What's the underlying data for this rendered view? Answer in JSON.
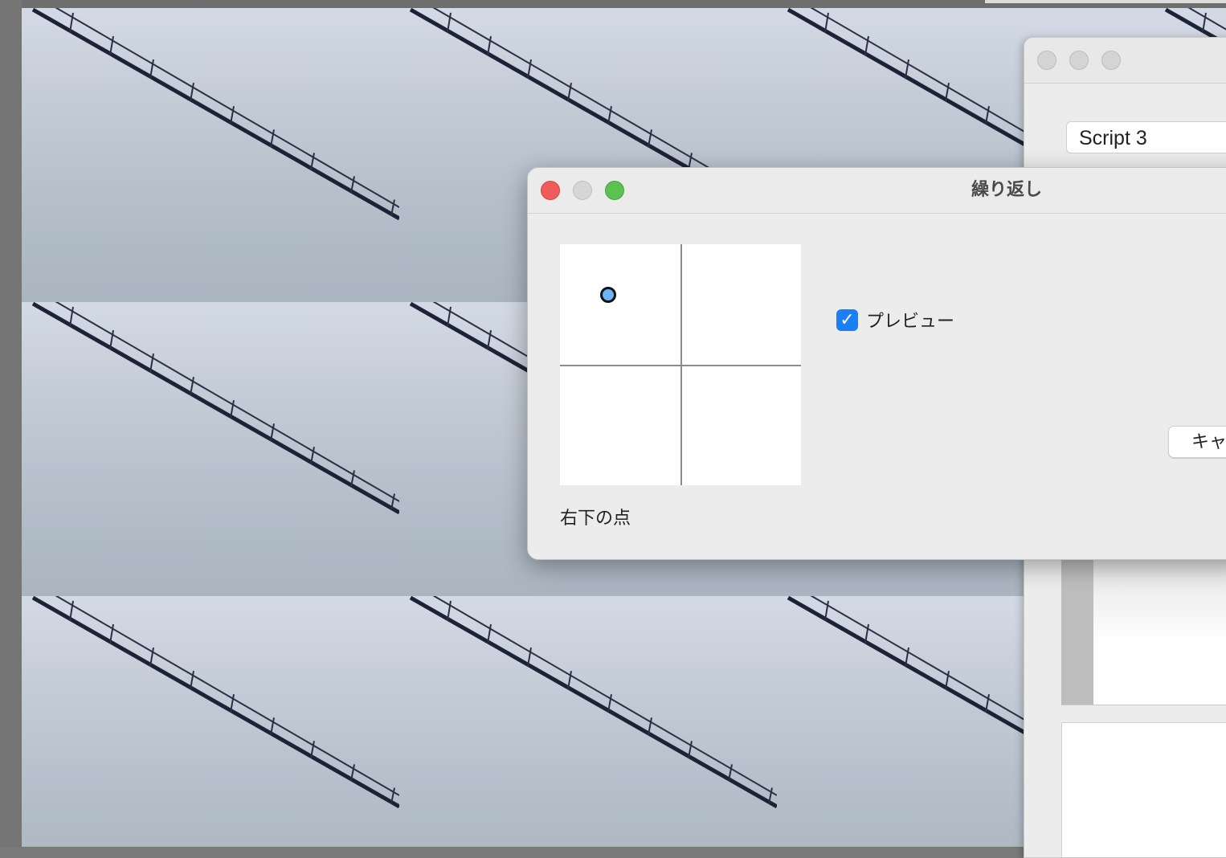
{
  "canvas": {
    "description_icon": "tiled-image-icon"
  },
  "script_window": {
    "script_select_value": "Script 3"
  },
  "dialog": {
    "title": "繰り返し",
    "point_caption": "右下の点",
    "preview_label": "プレビュー",
    "preview_checked": true,
    "cancel_label": "キャンセル"
  },
  "colors": {
    "close": "#ee5d57",
    "zoom": "#5ac34f",
    "checkbox_accent": "#1a7ef5",
    "point_fill": "#6cb4f5"
  }
}
